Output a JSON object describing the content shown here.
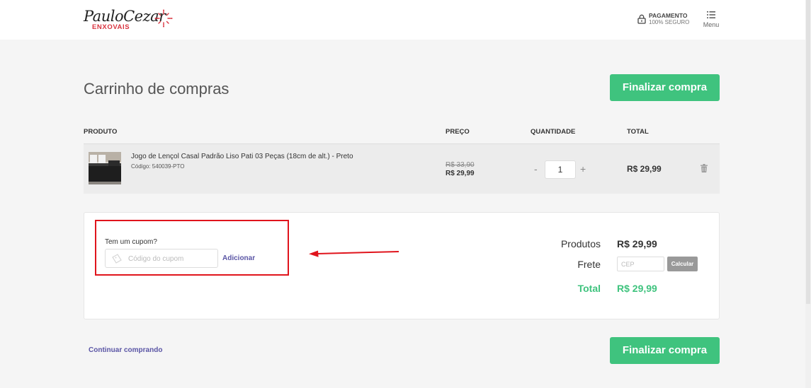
{
  "header": {
    "logo_main": "PauloCezar",
    "logo_sub": "ENXOVAIS",
    "secure_title": "PAGAMENTO",
    "secure_subtitle": "100% SEGURO",
    "menu_label": "Menu"
  },
  "page": {
    "title": "Carrinho de compras",
    "checkout_label": "Finalizar compra",
    "continue_label": "Continuar comprando"
  },
  "table": {
    "headers": {
      "product": "PRODUTO",
      "price": "PREÇO",
      "quantity": "QUANTIDADE",
      "total": "TOTAL"
    },
    "items": [
      {
        "name": "Jogo de Lençol Casal Padrão Liso Pati 03 Peças (18cm de alt.) - Preto",
        "code": "Código: 540039-PTO",
        "old_price": "R$ 33,90",
        "price": "R$ 29,99",
        "quantity": "1",
        "minus": "-",
        "plus": "+",
        "total": "R$ 29,99"
      }
    ]
  },
  "coupon": {
    "label": "Tem um cupom?",
    "placeholder": "Código do cupom",
    "add_label": "Adicionar"
  },
  "summary": {
    "products_label": "Produtos",
    "products_value": "R$ 29,99",
    "shipping_label": "Frete",
    "cep_placeholder": "CEP",
    "calculate_label": "Calcular",
    "total_label": "Total",
    "total_value": "R$ 29,99"
  },
  "colors": {
    "accent_green": "#3fc37e",
    "link_purple": "#5a55a5",
    "highlight_red": "#e0141c",
    "brand_red": "#d9333f"
  },
  "icons": [
    "lock-icon",
    "menu-icon",
    "trash-icon",
    "ticket-icon",
    "arrow-left-icon",
    "logo-burst-icon"
  ]
}
